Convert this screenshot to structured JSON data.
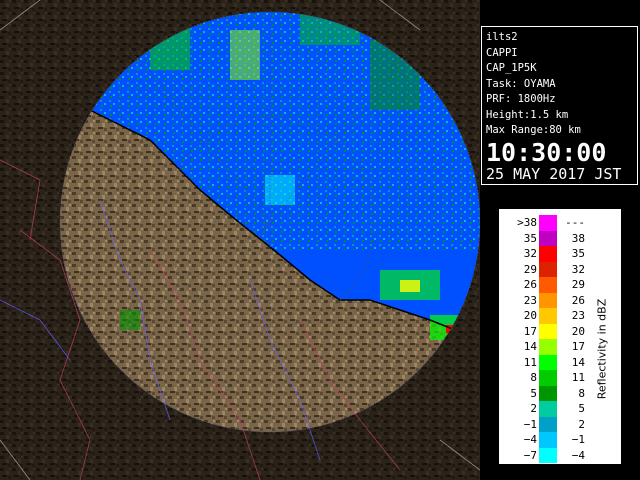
{
  "info": {
    "station": "ilts2",
    "product": "CAPPI",
    "scan": "CAP_1P5K",
    "task": "Task: OYAMA",
    "prf": "PRF: 1800Hz",
    "height": "Height:1.5 km",
    "max_range": "Max Range:80 km",
    "time": "10:30:00",
    "date": "25 MAY 2017 JST"
  },
  "legend": {
    "unit_label": "Reflectivity in dBZ",
    "rows": [
      {
        "lo": ">38",
        "hi": "---",
        "color": "#ff00ff"
      },
      {
        "lo": "35",
        "hi": "38",
        "color": "#c000c0"
      },
      {
        "lo": "32",
        "hi": "35",
        "color": "#ff0000"
      },
      {
        "lo": "29",
        "hi": "32",
        "color": "#dd2200"
      },
      {
        "lo": "26",
        "hi": "29",
        "color": "#ff5a00"
      },
      {
        "lo": "23",
        "hi": "26",
        "color": "#ff9600"
      },
      {
        "lo": "20",
        "hi": "23",
        "color": "#ffc800"
      },
      {
        "lo": "17",
        "hi": "20",
        "color": "#ffff00"
      },
      {
        "lo": "14",
        "hi": "17",
        "color": "#96ff00"
      },
      {
        "lo": "11",
        "hi": "14",
        "color": "#00ff00"
      },
      {
        "lo": "8",
        "hi": "11",
        "color": "#00cc00"
      },
      {
        "lo": "5",
        "hi": "8",
        "color": "#009600"
      },
      {
        "lo": "2",
        "hi": "5",
        "color": "#00cca0"
      },
      {
        "lo": "−1",
        "hi": "2",
        "color": "#00a0c8"
      },
      {
        "lo": "−4",
        "hi": "−1",
        "color": "#00c8ff"
      },
      {
        "lo": "−7",
        "hi": "−4",
        "color": "#00ffff"
      }
    ]
  },
  "colors": {
    "sea": "#0050ff",
    "land": "#7a6548",
    "background": "#000000",
    "range_ring": "#666666"
  }
}
